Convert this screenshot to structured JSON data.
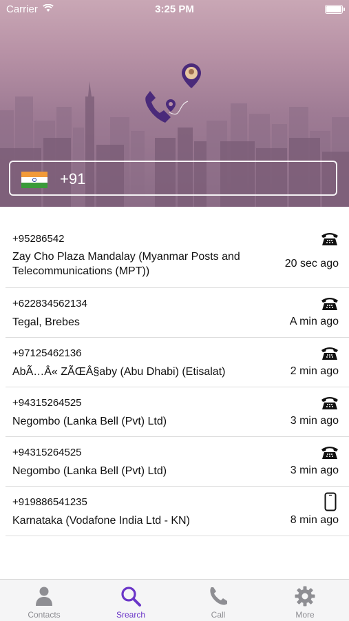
{
  "status_bar": {
    "carrier": "Carrier",
    "time": "3:25 PM"
  },
  "search": {
    "country_flag": "india-flag",
    "dial_code": "+91"
  },
  "recents": [
    {
      "number": "+95286542",
      "location": "Zay Cho Plaza  Mandalay (Myanmar Posts and Telecommunications (MPT))",
      "time": "20 sec ago",
      "icon": "landline-phone-icon"
    },
    {
      "number": "+622834562134",
      "location": "Tegal, Brebes",
      "time": "A min ago",
      "icon": "landline-phone-icon"
    },
    {
      "number": "+97125462136",
      "location": "AbÃ…Â« ZÃŒÂ§aby (Abu Dhabi) (Etisalat)",
      "time": "2 min ago",
      "icon": "landline-phone-icon"
    },
    {
      "number": "+94315264525",
      "location": "Negombo (Lanka Bell (Pvt) Ltd)",
      "time": "3 min ago",
      "icon": "landline-phone-icon"
    },
    {
      "number": "+94315264525",
      "location": "Negombo (Lanka Bell (Pvt) Ltd)",
      "time": "3 min ago",
      "icon": "landline-phone-icon"
    },
    {
      "number": "+919886541235",
      "location": "Karnataka (Vodafone India Ltd - KN)",
      "time": "8 min ago",
      "icon": "mobile-phone-icon"
    }
  ],
  "tabs": [
    {
      "label": "Contacts",
      "icon": "person-icon",
      "active": false
    },
    {
      "label": "Srearch",
      "icon": "search-icon",
      "active": true
    },
    {
      "label": "Call",
      "icon": "phone-icon",
      "active": false
    },
    {
      "label": "More",
      "icon": "gear-icon",
      "active": false
    }
  ],
  "colors": {
    "accent": "#6a35c8",
    "tab_inactive": "#8e8e93",
    "header_tint": "#9e7b94"
  }
}
